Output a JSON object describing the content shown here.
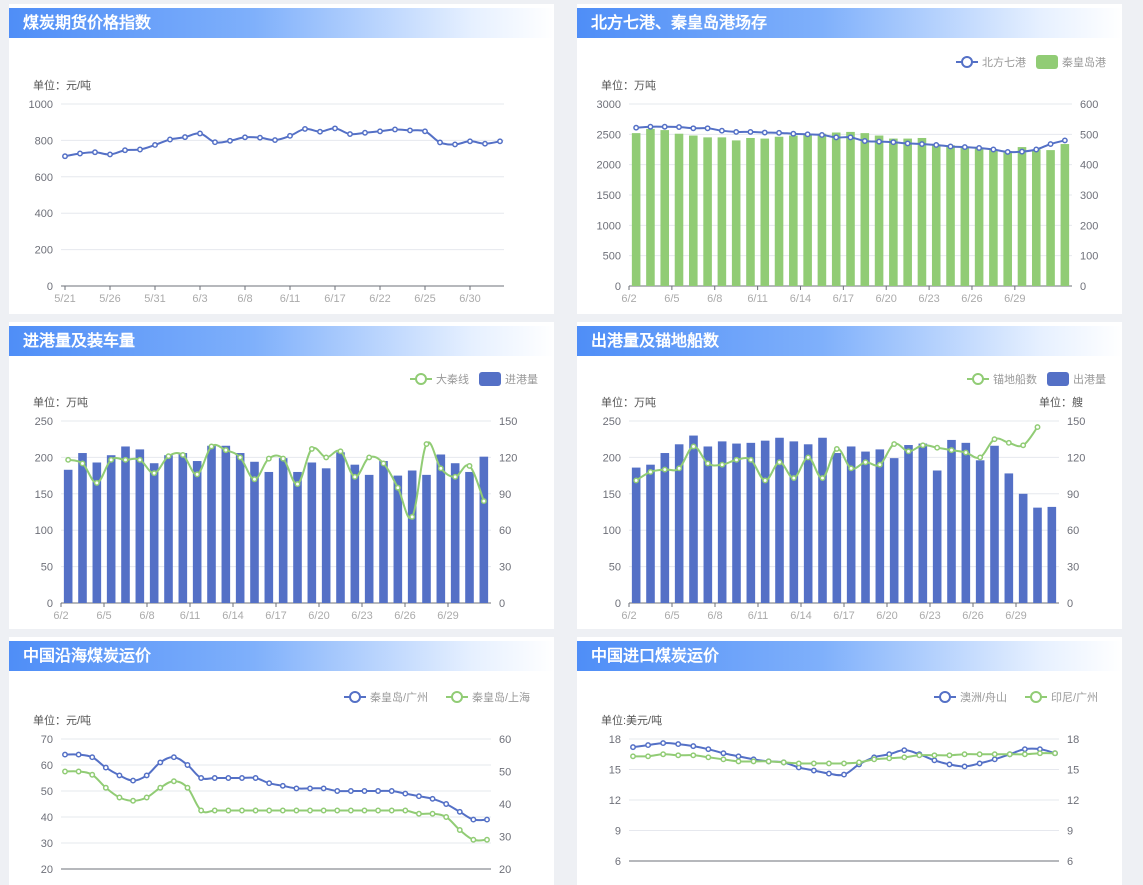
{
  "panels": [
    {
      "title": "煤炭期货价格指数"
    },
    {
      "title": "北方七港、秦皇岛港场存"
    },
    {
      "title": "进港量及装车量"
    },
    {
      "title": "出港量及锚地船数"
    },
    {
      "title": "中国沿海煤炭运价"
    },
    {
      "title": "中国进口煤炭运价"
    }
  ],
  "colors": {
    "blue": "#5470c6",
    "green": "#91cc75",
    "grid": "#e6e8ee",
    "axis": "#6e7079",
    "muted": "#999999"
  },
  "chart_data": [
    {
      "type": "line",
      "unit_left": "单位：元/吨",
      "ylim": [
        0,
        1000
      ],
      "y_ticks": [
        "0",
        "200",
        "400",
        "600",
        "800",
        "1000"
      ],
      "x_ticks": [
        "5/21",
        "5/26",
        "5/31",
        "6/3",
        "6/8",
        "6/11",
        "6/17",
        "6/22",
        "6/25",
        "6/30"
      ],
      "series": [
        {
          "axis": "left",
          "color": "blue",
          "values": [
            713,
            728,
            735,
            723,
            746,
            750,
            775,
            805,
            818,
            838,
            790,
            798,
            817,
            815,
            802,
            825,
            863,
            848,
            866,
            835,
            842,
            850,
            860,
            855,
            850,
            789,
            778,
            795,
            782,
            795
          ]
        }
      ]
    },
    {
      "type": "bar",
      "unit_left": "单位：万吨",
      "ylim": [
        0,
        3000
      ],
      "y2lim": [
        0,
        600
      ],
      "y_ticks": [
        "0",
        "500",
        "1000",
        "1500",
        "2000",
        "2500",
        "3000"
      ],
      "y2_ticks": [
        "0",
        "100",
        "200",
        "300",
        "400",
        "500",
        "600"
      ],
      "x_ticks": [
        "6/2",
        "6/5",
        "6/8",
        "6/11",
        "6/14",
        "6/17",
        "6/20",
        "6/23",
        "6/26",
        "6/29"
      ],
      "legend": [
        "北方七港",
        "秦皇岛港"
      ],
      "series": [
        {
          "name": "秦皇岛港",
          "axis": "left",
          "kind": "bar",
          "color": "green",
          "values": [
            2520,
            2590,
            2570,
            2510,
            2480,
            2450,
            2450,
            2400,
            2440,
            2430,
            2460,
            2480,
            2500,
            2510,
            2530,
            2540,
            2520,
            2480,
            2430,
            2430,
            2440,
            2330,
            2320,
            2280,
            2280,
            2250,
            2220,
            2290,
            2250,
            2240,
            2340
          ]
        },
        {
          "name": "北方七港",
          "axis": "right",
          "kind": "line",
          "color": "blue",
          "values": [
            522,
            525,
            525,
            524,
            520,
            520,
            512,
            508,
            508,
            506,
            505,
            502,
            500,
            498,
            490,
            490,
            478,
            476,
            474,
            470,
            468,
            465,
            460,
            458,
            455,
            450,
            442,
            443,
            450,
            468,
            480
          ]
        }
      ]
    },
    {
      "type": "bar",
      "unit_left": "单位：万吨",
      "ylim": [
        0,
        250
      ],
      "y2lim": [
        0,
        150
      ],
      "y_ticks": [
        "0",
        "50",
        "100",
        "150",
        "200",
        "250"
      ],
      "y2_ticks": [
        "0",
        "30",
        "60",
        "90",
        "120",
        "150"
      ],
      "x_ticks": [
        "6/2",
        "6/5",
        "6/8",
        "6/11",
        "6/14",
        "6/17",
        "6/20",
        "6/23",
        "6/26",
        "6/29"
      ],
      "legend": [
        "大秦线",
        "进港量"
      ],
      "series": [
        {
          "name": "进港量",
          "axis": "left",
          "kind": "bar",
          "color": "blue",
          "values": [
            183,
            206,
            193,
            203,
            215,
            211,
            192,
            203,
            206,
            195,
            216,
            216,
            206,
            194,
            180,
            199,
            180,
            193,
            185,
            207,
            190,
            176,
            195,
            175,
            182,
            176,
            204,
            192,
            180,
            201
          ]
        },
        {
          "name": "大秦线",
          "axis": "right",
          "kind": "line",
          "color": "green",
          "values": [
            118,
            115,
            99,
            118,
            118,
            118,
            107,
            121,
            122,
            106,
            129,
            126,
            120,
            102,
            119,
            119,
            98,
            127,
            120,
            125,
            104,
            120,
            115,
            95,
            71,
            131,
            111,
            104,
            113,
            84
          ]
        }
      ]
    },
    {
      "type": "bar",
      "unit_left": "单位：万吨",
      "unit_right": "单位：艘",
      "ylim": [
        0,
        250
      ],
      "y2lim": [
        0,
        150
      ],
      "y_ticks": [
        "0",
        "50",
        "100",
        "150",
        "200",
        "250"
      ],
      "y2_ticks": [
        "0",
        "30",
        "60",
        "90",
        "120",
        "150"
      ],
      "x_ticks": [
        "6/2",
        "6/5",
        "6/8",
        "6/11",
        "6/14",
        "6/17",
        "6/20",
        "6/23",
        "6/26",
        "6/29"
      ],
      "legend": [
        "锚地船数",
        "出港量"
      ],
      "series": [
        {
          "name": "出港量",
          "axis": "left",
          "kind": "bar",
          "color": "blue",
          "values": [
            186,
            190,
            206,
            218,
            230,
            215,
            222,
            219,
            220,
            223,
            227,
            222,
            218,
            227,
            206,
            215,
            208,
            211,
            199,
            217,
            219,
            182,
            224,
            220,
            196,
            216,
            178,
            150,
            131,
            132
          ]
        },
        {
          "name": "锚地船数",
          "axis": "right",
          "kind": "line",
          "color": "green",
          "values": [
            101,
            108,
            110,
            111,
            129,
            115,
            114,
            118,
            118,
            101,
            116,
            103,
            120,
            103,
            127,
            111,
            116,
            114,
            131,
            125,
            130,
            128,
            126,
            124,
            120,
            135,
            132,
            130,
            145
          ]
        }
      ]
    },
    {
      "type": "line",
      "unit_left": "单位：元/吨",
      "ylim": [
        20,
        70
      ],
      "y2lim": [
        20,
        60
      ],
      "y_ticks": [
        "20",
        "30",
        "40",
        "50",
        "60",
        "70"
      ],
      "y2_ticks": [
        "20",
        "30",
        "40",
        "50",
        "60"
      ],
      "legend": [
        "秦皇岛/广州",
        "秦皇岛/上海"
      ],
      "series": [
        {
          "name": "秦皇岛/广州",
          "axis": "left",
          "color": "blue",
          "values": [
            64,
            64,
            63,
            59,
            56,
            54,
            56,
            61,
            63,
            60,
            55,
            55,
            55,
            55,
            55,
            53,
            52,
            51,
            51,
            51,
            50,
            50,
            50,
            50,
            50,
            49,
            48,
            47,
            45,
            42,
            39,
            39
          ]
        },
        {
          "name": "秦皇岛/上海",
          "axis": "right",
          "color": "green",
          "values": [
            50,
            50,
            49,
            45,
            42,
            41,
            42,
            45,
            47,
            45,
            38,
            38,
            38,
            38,
            38,
            38,
            38,
            38,
            38,
            38,
            38,
            38,
            38,
            38,
            38,
            38,
            37,
            37,
            36,
            32,
            29,
            29
          ]
        }
      ]
    },
    {
      "type": "line",
      "unit_left": "单位:美元/吨",
      "ylim": [
        6,
        18
      ],
      "y2lim": [
        6,
        18
      ],
      "y_ticks": [
        "6",
        "9",
        "12",
        "15",
        "18"
      ],
      "y2_ticks": [
        "6",
        "9",
        "12",
        "15",
        "18"
      ],
      "legend": [
        "澳洲/舟山",
        "印尼/广州"
      ],
      "series": [
        {
          "name": "澳洲/舟山",
          "axis": "left",
          "color": "blue",
          "values": [
            17.2,
            17.4,
            17.6,
            17.5,
            17.3,
            17.0,
            16.6,
            16.3,
            16.0,
            15.8,
            15.7,
            15.2,
            14.9,
            14.6,
            14.5,
            15.5,
            16.2,
            16.5,
            16.9,
            16.5,
            15.9,
            15.5,
            15.3,
            15.6,
            16.0,
            16.5,
            17.0,
            17.0,
            16.6
          ]
        },
        {
          "name": "印尼/广州",
          "axis": "right",
          "color": "green",
          "values": [
            16.3,
            16.3,
            16.5,
            16.4,
            16.4,
            16.2,
            16.0,
            15.8,
            15.8,
            15.8,
            15.7,
            15.6,
            15.6,
            15.6,
            15.6,
            15.7,
            16.0,
            16.1,
            16.2,
            16.4,
            16.4,
            16.4,
            16.5,
            16.5,
            16.5,
            16.5,
            16.5,
            16.6,
            16.6
          ]
        }
      ]
    }
  ]
}
